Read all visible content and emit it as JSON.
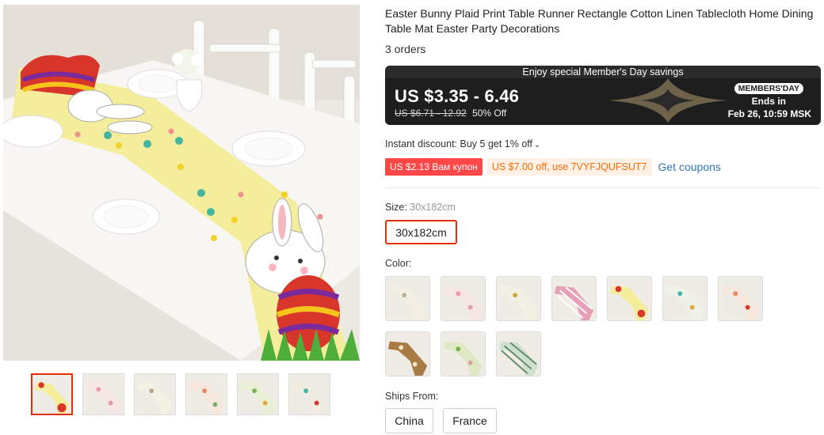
{
  "product": {
    "title": "Easter Bunny Plaid Print Table Runner Rectangle Cotton Linen Tablecloth Home Dining Table Mat Easter Party Decorations",
    "orders": "3 orders"
  },
  "promo": {
    "header": "Enjoy special Member's Day savings",
    "price": "US $3.35 - 6.46",
    "original_price": "US $6.71 - 12.92",
    "discount": "50% Off",
    "badge": "MEMBERS'DAY",
    "ends_label": "Ends in",
    "ends_date": "Feb 26, 10:59 MSK"
  },
  "instant_discount": "Instant discount: Buy 5 get 1% off",
  "coupons": {
    "red": "US $2.13 Вам купон",
    "orange": "US $7.00 off, use 7VYFJQUFSUT7",
    "link": "Get coupons"
  },
  "size": {
    "label": "Size:",
    "selected": "30x182cm",
    "options": [
      "30x182cm"
    ]
  },
  "color": {
    "label": "Color:",
    "swatch_count": 10
  },
  "ships_from": {
    "label": "Ships From:",
    "options": [
      "China",
      "France"
    ]
  },
  "gallery": {
    "thumb_count": 6,
    "active_index": 0
  },
  "colors": {
    "accent_red": "#e62e04",
    "coupon_red": "#ff4747",
    "coupon_orange": "#ff6a00",
    "link_blue": "#3576b5",
    "promo_bg": "#1e1e1e",
    "runner_yellow": "#f4ed9c"
  }
}
